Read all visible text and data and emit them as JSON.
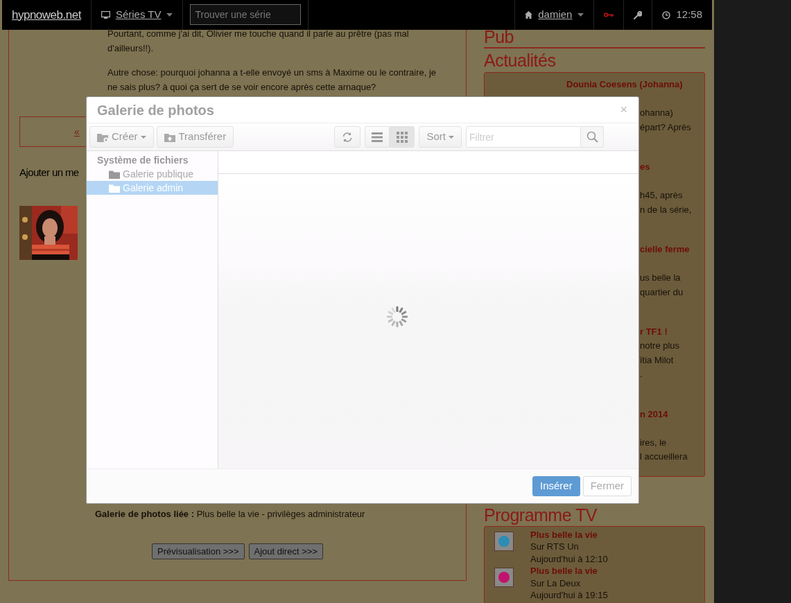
{
  "navbar": {
    "brand": "hypnoweb.net",
    "series_menu": "Séries TV",
    "search": {
      "placeholder": "Trouver une série"
    },
    "user_menu": "damien",
    "time": "12:58"
  },
  "article": {
    "paragraphs": [
      "Pourtant, comme j'ai dit, Olivier me touche quand il parle au prêtre (pas mal d'ailleurs!!).",
      "Autre chose: pourquoi johanna a t-elle envoyé un sms à Maxime ou le contraire, je ne sais plus? à quoi ça sert de se voir encore après cette arnaque?"
    ],
    "pager": "«",
    "comment_heading": "Ajouter un me",
    "avatar": {
      "kind": "picture"
    },
    "linked_gallery": {
      "label": "Galerie de photos liée :",
      "value": "Plus belle la vie - privilèges administrateur"
    },
    "buttons": [
      "Prévisualisation >>>",
      "Ajout direct >>>"
    ]
  },
  "sidebar": {
    "pub_heading": "Pub",
    "news_heading": "Actualités",
    "news": [
      {
        "title": "Dounia Coesens (Johanna)",
        "lines": [
          "ohanna)",
          "épart? Après"
        ]
      },
      {
        "title": "es",
        "lines": [
          "h45, après",
          "n de la série,"
        ]
      },
      {
        "title": "cielle ferme",
        "lines": [
          "us belle la",
          "quartier du"
        ]
      },
      {
        "title": "r TF1 !",
        "lines": [
          "notre plus",
          "ïtia Milot",
          "."
        ]
      },
      {
        "title": "n 2014",
        "lines": [
          "ires, le",
          "l accueillera"
        ]
      }
    ],
    "tv_heading": "Programme TV",
    "tv": [
      {
        "show": "Plus belle la vie",
        "channel": "Sur RTS Un",
        "time": "Aujourd'hui à 12:10",
        "color": "#2b8db5"
      },
      {
        "show": "Plus belle la vie",
        "channel": "Sur La Deux",
        "time": "Aujourd'hui à 19:15",
        "color": "#c2126f"
      }
    ]
  },
  "gallery_modal": {
    "title": "Galerie de photos",
    "close": "×",
    "toolbar": {
      "create": "Créer",
      "upload": "Transférer",
      "views": [
        {
          "kind": "list",
          "selected": false
        },
        {
          "kind": "grid",
          "selected": true
        }
      ],
      "sort": "Sort",
      "filter": {
        "placeholder": "Filtrer"
      }
    },
    "tree": {
      "root": "Système de fichiers",
      "children": [
        {
          "label": "Galerie publique",
          "selected": false
        },
        {
          "label": "Galerie admin",
          "selected": true
        }
      ]
    },
    "loading": true,
    "buttons": [
      {
        "label": "Insérer",
        "kind": "primary",
        "disabled": true
      },
      {
        "label": "Fermer",
        "kind": "secondary",
        "disabled": false
      }
    ]
  }
}
